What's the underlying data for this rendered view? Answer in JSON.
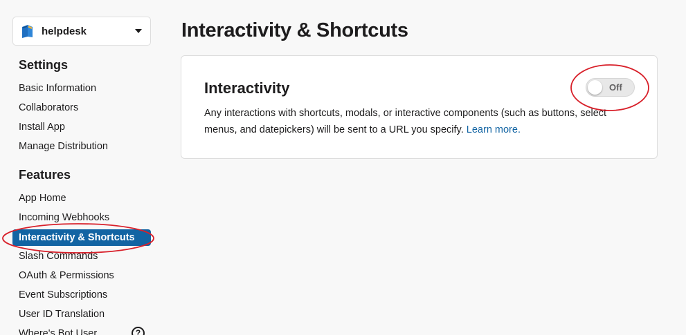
{
  "app": {
    "name": "helpdesk"
  },
  "sidebar": {
    "settings_title": "Settings",
    "settings_items": [
      {
        "label": "Basic Information"
      },
      {
        "label": "Collaborators"
      },
      {
        "label": "Install App"
      },
      {
        "label": "Manage Distribution"
      }
    ],
    "features_title": "Features",
    "features_items": [
      {
        "label": "App Home"
      },
      {
        "label": "Incoming Webhooks"
      },
      {
        "label": "Interactivity & Shortcuts",
        "active": true
      },
      {
        "label": "Slash Commands"
      },
      {
        "label": "OAuth & Permissions"
      },
      {
        "label": "Event Subscriptions"
      },
      {
        "label": "User ID Translation"
      },
      {
        "label": "Where's Bot User"
      }
    ],
    "help_glyph": "?"
  },
  "main": {
    "title": "Interactivity & Shortcuts",
    "card": {
      "title": "Interactivity",
      "description": "Any interactions with shortcuts, modals, or interactive components (such as buttons, select menus, and datepickers) will be sent to a URL you specify.",
      "learn_more": "Learn more.",
      "toggle": {
        "label": "Off",
        "state": false
      }
    }
  },
  "colors": {
    "accent": "#1264a3",
    "annotation": "#d8202a",
    "background": "#f8f8f8"
  },
  "icons": {
    "app_logo": "book-icon",
    "caret": "chevron-down-icon",
    "help": "help-icon"
  }
}
